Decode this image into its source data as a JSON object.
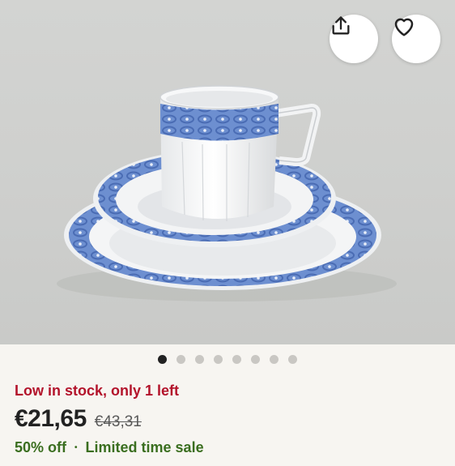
{
  "listing": {
    "image_alt": "Blue and white porcelain cup, saucer and plate set",
    "share_icon": "share-icon",
    "favorite_icon": "heart-icon",
    "carousel": {
      "total": 8,
      "active_index": 0
    }
  },
  "pricing": {
    "stock_notice": "Low in stock, only 1 left",
    "price": "€21,65",
    "original_price": "€43,31",
    "discount": "50% off",
    "separator": "•",
    "sale_label": "Limited time sale"
  },
  "colors": {
    "stock": "#b3132b",
    "sale": "#3a6e1f",
    "porcelain_blue": "#6d8fd0"
  }
}
